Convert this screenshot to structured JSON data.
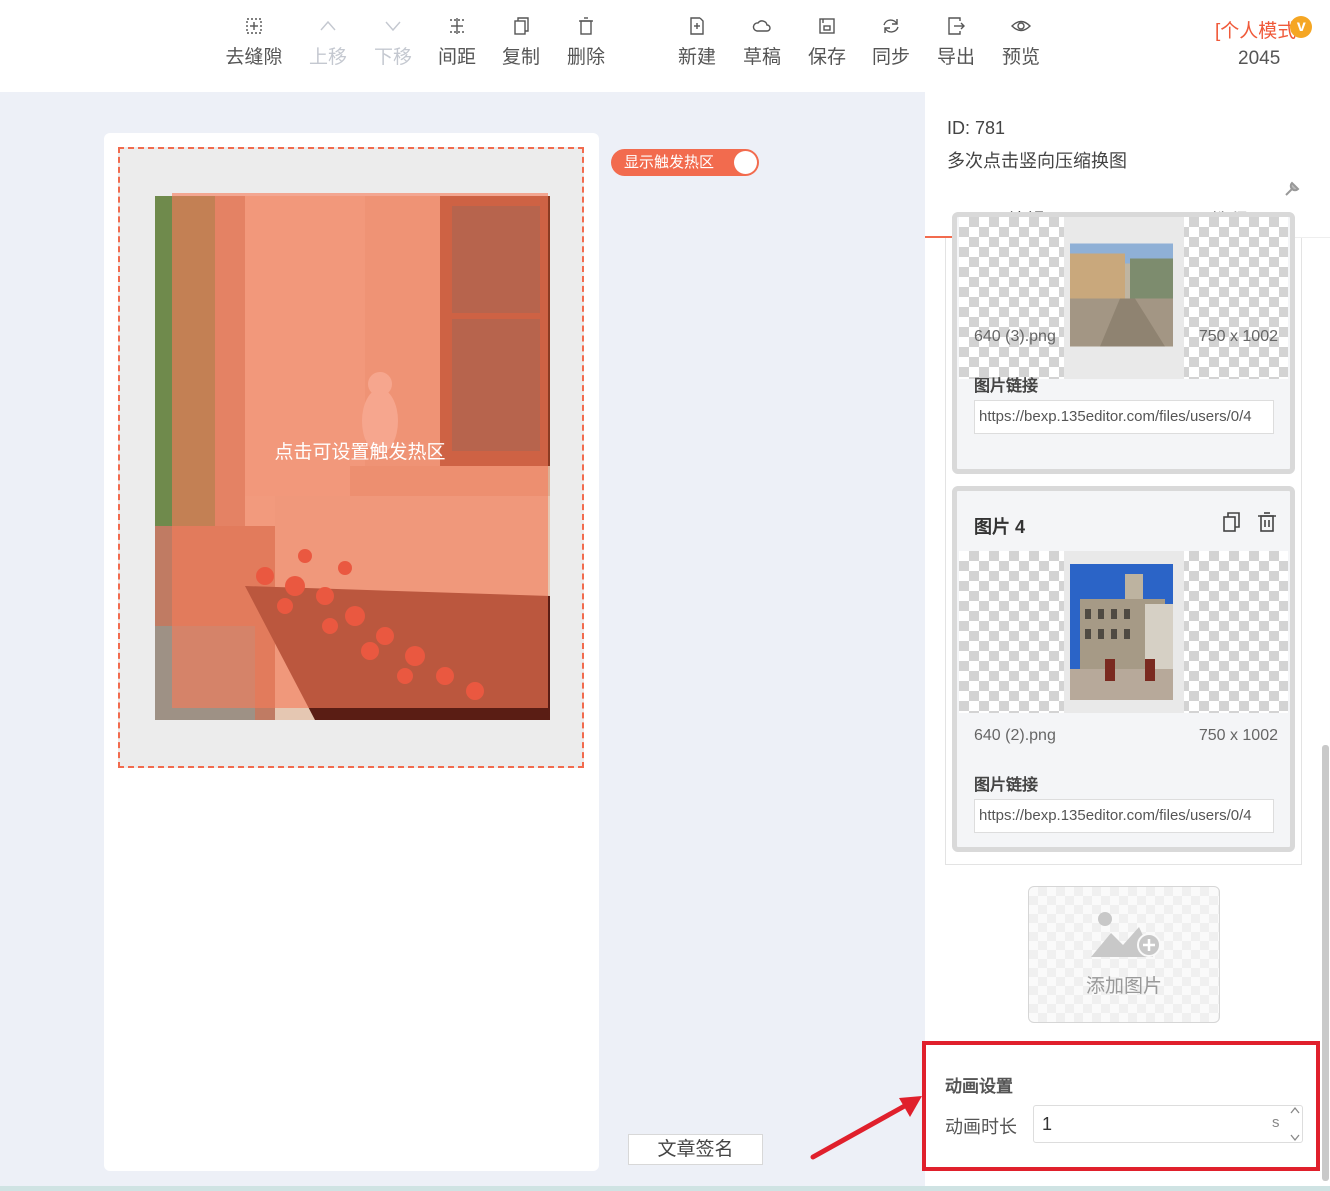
{
  "toolbar": {
    "remove_gap": "去缝隙",
    "move_up": "上移",
    "move_down": "下移",
    "spacing": "间距",
    "copy": "复制",
    "delete": "删除",
    "new": "新建",
    "draft": "草稿",
    "save": "保存",
    "sync": "同步",
    "export": "导出",
    "preview": "预览"
  },
  "account": {
    "mode": "[个人模式",
    "badge": "v",
    "count": "2045"
  },
  "canvas": {
    "hotzone_toggle_label": "显示触发热区",
    "hotzone_hint": "点击可设置触发热区",
    "signature_button": "文章签名"
  },
  "panel": {
    "id": "ID: 781",
    "name": "多次点击竖向压缩换图",
    "tabs": [
      "编辑",
      "教程"
    ],
    "cards": [
      {
        "title": "",
        "file_name": "640 (3).png",
        "file_size": "750 x 1002",
        "link_label": "图片链接",
        "link_value": "https://bexp.135editor.com/files/users/0/4"
      },
      {
        "title": "图片 4",
        "file_name": "640 (2).png",
        "file_size": "750 x 1002",
        "link_label": "图片链接",
        "link_value": "https://bexp.135editor.com/files/users/0/4"
      }
    ],
    "add_image_label": "添加图片",
    "animation": {
      "title": "动画设置",
      "duration_label": "动画时长",
      "duration_value": "1",
      "unit": "s"
    }
  },
  "colors": {
    "accent": "#f26b4e",
    "highlight": "#e0202c"
  }
}
